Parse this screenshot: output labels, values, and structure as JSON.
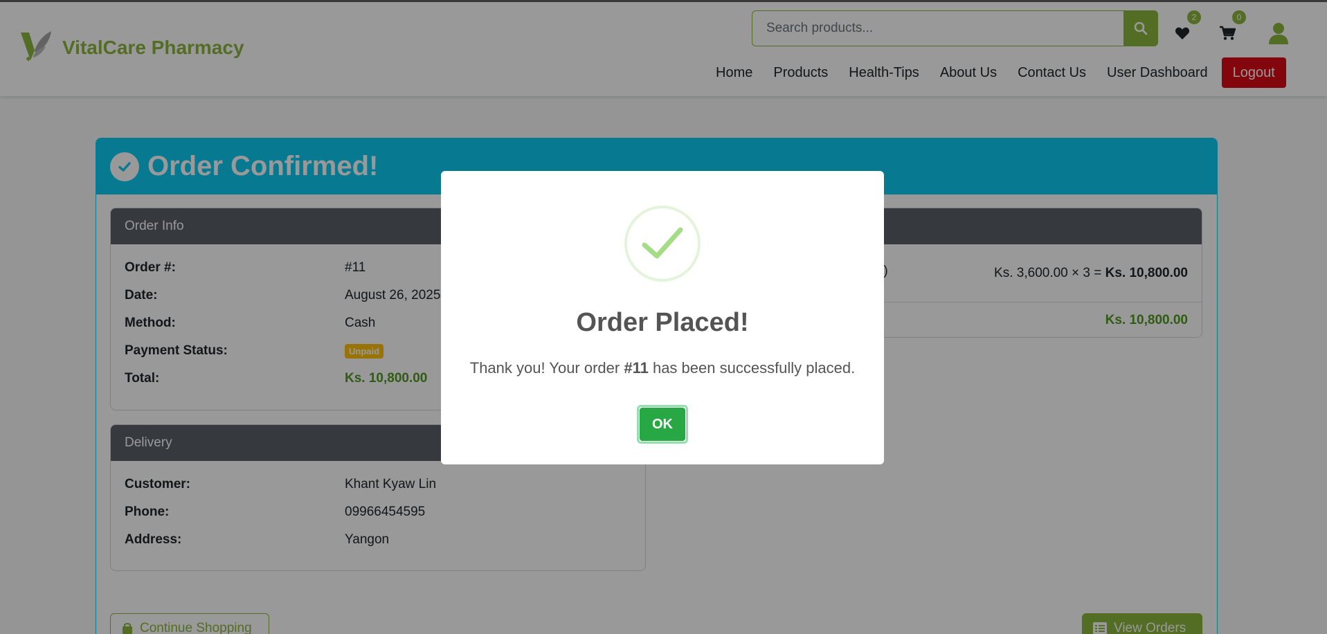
{
  "brand": {
    "name": "VitalCare Pharmacy",
    "color": "#8cb63c"
  },
  "search": {
    "placeholder": "Search products..."
  },
  "header_icons": {
    "wishlist_count": "2",
    "cart_count": "0"
  },
  "nav": {
    "links": [
      "Home",
      "Products",
      "Health-Tips",
      "About Us",
      "Contact Us",
      "User Dashboard"
    ],
    "logout": "Logout"
  },
  "confirmation": {
    "title": "Order Confirmed!",
    "accent": "#0dcaf0"
  },
  "order_info": {
    "heading": "Order Info",
    "rows": [
      {
        "label": "Order #:",
        "value": "#11"
      },
      {
        "label": "Date:",
        "value": "August 26, 2025"
      },
      {
        "label": "Method:",
        "value": "Cash"
      },
      {
        "label": "Payment Status:",
        "value": "Unpaid"
      },
      {
        "label": "Total:",
        "value": "Ks. 10,800.00"
      }
    ]
  },
  "delivery": {
    "heading": "Delivery",
    "rows": [
      {
        "label": "Customer:",
        "value": "Khant Kyaw Lin"
      },
      {
        "label": "Phone:",
        "value": "09966454595"
      },
      {
        "label": "Address:",
        "value": "Yangon"
      }
    ]
  },
  "items": {
    "product_fragment": "tirc)",
    "line_price": "Ks. 3,600.00 × 3 =",
    "line_total": "Ks. 10,800.00",
    "grand_total": "Ks. 10,800.00"
  },
  "actions": {
    "continue_shopping": "Continue Shopping",
    "view_orders": "View Orders"
  },
  "modal": {
    "title": "Order Placed!",
    "text_before": "Thank you! Your order ",
    "order_no": "#11",
    "text_after": " has been successfully placed.",
    "ok": "OK"
  }
}
